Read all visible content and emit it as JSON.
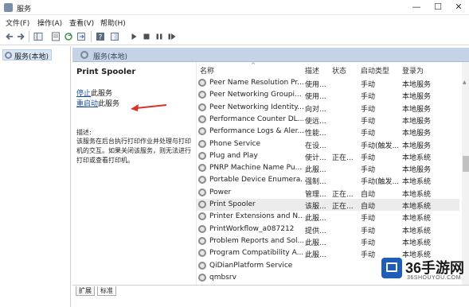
{
  "window": {
    "title": "服务",
    "minimize": "—",
    "maximize": "☐",
    "close": "✕"
  },
  "menu": [
    {
      "label": "文件(F)"
    },
    {
      "label": "操作(A)"
    },
    {
      "label": "查看(V)"
    },
    {
      "label": "帮助(H)"
    }
  ],
  "toolbar": {
    "icons": [
      "back-icon",
      "forward-icon",
      "console-tree-icon",
      "properties-icon",
      "refresh-icon",
      "export-icon",
      "help-icon",
      "show-hide-icon",
      "start-icon",
      "stop-icon",
      "pause-icon",
      "restart-icon"
    ]
  },
  "tree": {
    "root_label": "服务(本地)"
  },
  "main": {
    "header_label": "服务(本地)"
  },
  "details": {
    "service_name": "Print Spooler",
    "stop_link": "停止",
    "stop_suffix": "此服务",
    "restart_link": "重启动",
    "restart_suffix": "此服务",
    "desc_label": "描述:",
    "desc_text": "该服务在后台执行打印作业并处理与打印机的交互。如果关闭该服务，则无法进行打印或查看打印机。",
    "arrow_color": "#d9342b"
  },
  "columns": {
    "name": "名称",
    "desc": "描述",
    "status": "状态",
    "startup": "启动类型",
    "logon": "登录为"
  },
  "services": [
    {
      "name": "Peer Name Resolution Pr...",
      "desc": "使用...",
      "status": "",
      "startup": "手动",
      "logon": "本地服务"
    },
    {
      "name": "Peer Networking Groupi...",
      "desc": "使用...",
      "status": "",
      "startup": "手动",
      "logon": "本地服务"
    },
    {
      "name": "Peer Networking Identity...",
      "desc": "向对...",
      "status": "",
      "startup": "手动",
      "logon": "本地服务"
    },
    {
      "name": "Performance Counter DL...",
      "desc": "使远...",
      "status": "",
      "startup": "手动",
      "logon": "本地服务"
    },
    {
      "name": "Performance Logs & Aler...",
      "desc": "性能...",
      "status": "",
      "startup": "手动",
      "logon": "本地服务"
    },
    {
      "name": "Phone Service",
      "desc": "在设...",
      "status": "",
      "startup": "手动(触发...",
      "logon": "本地服务"
    },
    {
      "name": "Plug and Play",
      "desc": "使计...",
      "status": "正在...",
      "startup": "手动",
      "logon": "本地系统"
    },
    {
      "name": "PNRP Machine Name Pu...",
      "desc": "此服...",
      "status": "",
      "startup": "手动",
      "logon": "本地服务"
    },
    {
      "name": "Portable Device Enumera...",
      "desc": "强制...",
      "status": "",
      "startup": "手动(触发...",
      "logon": "本地系统"
    },
    {
      "name": "Power",
      "desc": "管理...",
      "status": "正在...",
      "startup": "自动",
      "logon": "本地系统"
    },
    {
      "name": "Print Spooler",
      "desc": "该服...",
      "status": "正在...",
      "startup": "自动",
      "logon": "本地系统",
      "selected": true
    },
    {
      "name": "Printer Extensions and N...",
      "desc": "此服...",
      "status": "",
      "startup": "手动",
      "logon": "本地系统"
    },
    {
      "name": "PrintWorkflow_a087212",
      "desc": "提供...",
      "status": "",
      "startup": "手动",
      "logon": "本地系统"
    },
    {
      "name": "Problem Reports and Sol...",
      "desc": "此服...",
      "status": "",
      "startup": "手动",
      "logon": "本地系统"
    },
    {
      "name": "Program Compatibility A...",
      "desc": "此服...",
      "status": "",
      "startup": "手动",
      "logon": "本地系统"
    },
    {
      "name": "QiDianPlatform Service",
      "desc": "",
      "status": "",
      "startup": "",
      "logon": ""
    },
    {
      "name": "qmbsrv",
      "desc": "",
      "status": "",
      "startup": "",
      "logon": ""
    }
  ],
  "tabs": [
    {
      "label": "扩展"
    },
    {
      "label": "标准",
      "active": true
    }
  ],
  "watermark": {
    "text": "36手游网",
    "url": "36SHOUYOU.COM",
    "brand_color": "#1f5db8"
  }
}
